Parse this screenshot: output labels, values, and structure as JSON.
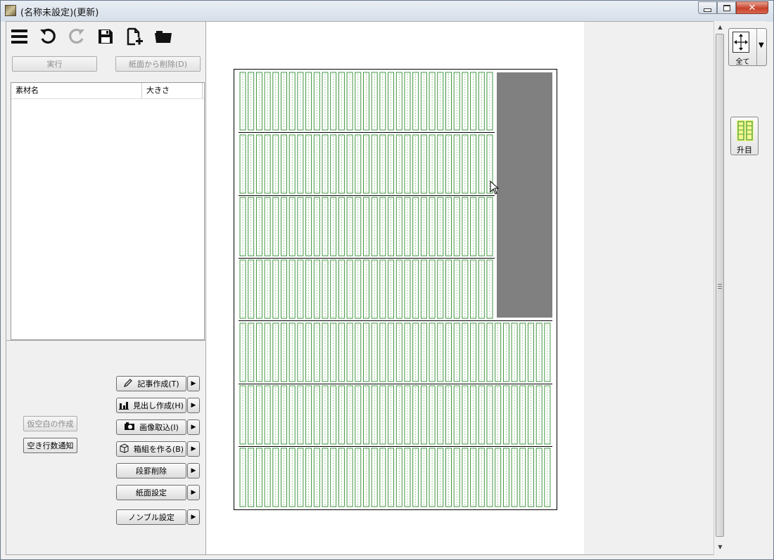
{
  "window": {
    "title": "(名称未設定)(更新)"
  },
  "left_panel": {
    "run_button": "実行",
    "delete_button": "紙面から削除(D)",
    "list_headers": [
      "素材名",
      "大きさ"
    ],
    "temp_blank_button": "仮空白の作成",
    "empty_rows_button": "空き行数通知",
    "actions": [
      {
        "label": "記事作成(T)",
        "icon": "pencil-icon"
      },
      {
        "label": "見出し作成(H)",
        "icon": "bar-chart-icon"
      },
      {
        "label": "画像取込(I)",
        "icon": "camera-icon"
      },
      {
        "label": "箱組を作る(B)",
        "icon": "box-icon"
      },
      {
        "label": "段罫削除",
        "icon": ""
      },
      {
        "label": "紙面設定",
        "icon": ""
      },
      {
        "label": "ノンブル設定",
        "icon": ""
      }
    ]
  },
  "right_panel": {
    "zoom_all_label": "全て",
    "grid_label": "升目"
  },
  "colors": {
    "grid_green": "#2e8b2e",
    "block_gray": "#808080"
  }
}
